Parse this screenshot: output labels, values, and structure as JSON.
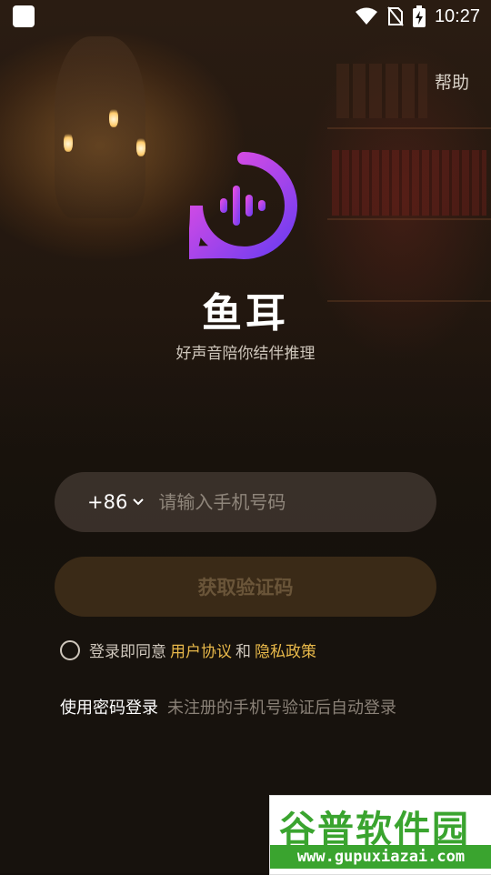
{
  "status_bar": {
    "time": "10:27",
    "icons": [
      "app-icon",
      "wifi-icon",
      "no-sim-icon",
      "battery-charging-icon"
    ]
  },
  "header": {
    "help_label": "帮助"
  },
  "brand": {
    "name": "鱼耳",
    "slogan": "好声音陪你结伴推理",
    "logo_icon": "soundwave-logo-icon",
    "accent_colors": [
      "#e24be6",
      "#7b3cf0"
    ]
  },
  "login": {
    "country_code": "+86",
    "phone_placeholder": "请输入手机号码",
    "phone_value": "",
    "get_code_label": "获取验证码",
    "agreement_prefix": "登录即同意",
    "user_agreement": "用户协议",
    "and": "和",
    "privacy_policy": "隐私政策",
    "agreement_checked": false,
    "password_login_label": "使用密码登录",
    "auto_register_hint": "未注册的手机号验证后自动登录"
  },
  "watermark": {
    "title": "谷普软件园",
    "url": "www.gupuxiazai.com"
  }
}
